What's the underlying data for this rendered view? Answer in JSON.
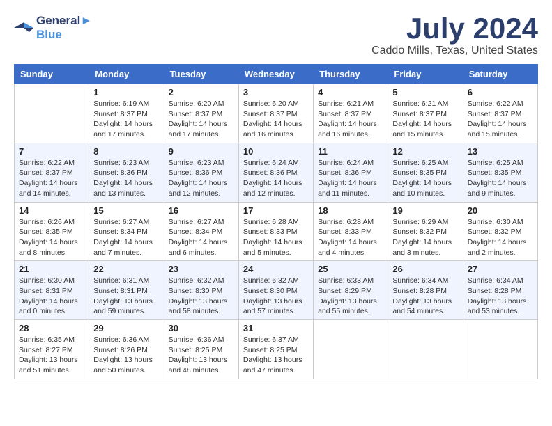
{
  "logo": {
    "line1": "General",
    "line2": "Blue"
  },
  "title": "July 2024",
  "location": "Caddo Mills, Texas, United States",
  "days_of_week": [
    "Sunday",
    "Monday",
    "Tuesday",
    "Wednesday",
    "Thursday",
    "Friday",
    "Saturday"
  ],
  "weeks": [
    [
      {
        "day": "",
        "info": ""
      },
      {
        "day": "1",
        "info": "Sunrise: 6:19 AM\nSunset: 8:37 PM\nDaylight: 14 hours\nand 17 minutes."
      },
      {
        "day": "2",
        "info": "Sunrise: 6:20 AM\nSunset: 8:37 PM\nDaylight: 14 hours\nand 17 minutes."
      },
      {
        "day": "3",
        "info": "Sunrise: 6:20 AM\nSunset: 8:37 PM\nDaylight: 14 hours\nand 16 minutes."
      },
      {
        "day": "4",
        "info": "Sunrise: 6:21 AM\nSunset: 8:37 PM\nDaylight: 14 hours\nand 16 minutes."
      },
      {
        "day": "5",
        "info": "Sunrise: 6:21 AM\nSunset: 8:37 PM\nDaylight: 14 hours\nand 15 minutes."
      },
      {
        "day": "6",
        "info": "Sunrise: 6:22 AM\nSunset: 8:37 PM\nDaylight: 14 hours\nand 15 minutes."
      }
    ],
    [
      {
        "day": "7",
        "info": "Sunrise: 6:22 AM\nSunset: 8:37 PM\nDaylight: 14 hours\nand 14 minutes."
      },
      {
        "day": "8",
        "info": "Sunrise: 6:23 AM\nSunset: 8:36 PM\nDaylight: 14 hours\nand 13 minutes."
      },
      {
        "day": "9",
        "info": "Sunrise: 6:23 AM\nSunset: 8:36 PM\nDaylight: 14 hours\nand 12 minutes."
      },
      {
        "day": "10",
        "info": "Sunrise: 6:24 AM\nSunset: 8:36 PM\nDaylight: 14 hours\nand 12 minutes."
      },
      {
        "day": "11",
        "info": "Sunrise: 6:24 AM\nSunset: 8:36 PM\nDaylight: 14 hours\nand 11 minutes."
      },
      {
        "day": "12",
        "info": "Sunrise: 6:25 AM\nSunset: 8:35 PM\nDaylight: 14 hours\nand 10 minutes."
      },
      {
        "day": "13",
        "info": "Sunrise: 6:25 AM\nSunset: 8:35 PM\nDaylight: 14 hours\nand 9 minutes."
      }
    ],
    [
      {
        "day": "14",
        "info": "Sunrise: 6:26 AM\nSunset: 8:35 PM\nDaylight: 14 hours\nand 8 minutes."
      },
      {
        "day": "15",
        "info": "Sunrise: 6:27 AM\nSunset: 8:34 PM\nDaylight: 14 hours\nand 7 minutes."
      },
      {
        "day": "16",
        "info": "Sunrise: 6:27 AM\nSunset: 8:34 PM\nDaylight: 14 hours\nand 6 minutes."
      },
      {
        "day": "17",
        "info": "Sunrise: 6:28 AM\nSunset: 8:33 PM\nDaylight: 14 hours\nand 5 minutes."
      },
      {
        "day": "18",
        "info": "Sunrise: 6:28 AM\nSunset: 8:33 PM\nDaylight: 14 hours\nand 4 minutes."
      },
      {
        "day": "19",
        "info": "Sunrise: 6:29 AM\nSunset: 8:32 PM\nDaylight: 14 hours\nand 3 minutes."
      },
      {
        "day": "20",
        "info": "Sunrise: 6:30 AM\nSunset: 8:32 PM\nDaylight: 14 hours\nand 2 minutes."
      }
    ],
    [
      {
        "day": "21",
        "info": "Sunrise: 6:30 AM\nSunset: 8:31 PM\nDaylight: 14 hours\nand 0 minutes."
      },
      {
        "day": "22",
        "info": "Sunrise: 6:31 AM\nSunset: 8:31 PM\nDaylight: 13 hours\nand 59 minutes."
      },
      {
        "day": "23",
        "info": "Sunrise: 6:32 AM\nSunset: 8:30 PM\nDaylight: 13 hours\nand 58 minutes."
      },
      {
        "day": "24",
        "info": "Sunrise: 6:32 AM\nSunset: 8:30 PM\nDaylight: 13 hours\nand 57 minutes."
      },
      {
        "day": "25",
        "info": "Sunrise: 6:33 AM\nSunset: 8:29 PM\nDaylight: 13 hours\nand 55 minutes."
      },
      {
        "day": "26",
        "info": "Sunrise: 6:34 AM\nSunset: 8:28 PM\nDaylight: 13 hours\nand 54 minutes."
      },
      {
        "day": "27",
        "info": "Sunrise: 6:34 AM\nSunset: 8:28 PM\nDaylight: 13 hours\nand 53 minutes."
      }
    ],
    [
      {
        "day": "28",
        "info": "Sunrise: 6:35 AM\nSunset: 8:27 PM\nDaylight: 13 hours\nand 51 minutes."
      },
      {
        "day": "29",
        "info": "Sunrise: 6:36 AM\nSunset: 8:26 PM\nDaylight: 13 hours\nand 50 minutes."
      },
      {
        "day": "30",
        "info": "Sunrise: 6:36 AM\nSunset: 8:25 PM\nDaylight: 13 hours\nand 48 minutes."
      },
      {
        "day": "31",
        "info": "Sunrise: 6:37 AM\nSunset: 8:25 PM\nDaylight: 13 hours\nand 47 minutes."
      },
      {
        "day": "",
        "info": ""
      },
      {
        "day": "",
        "info": ""
      },
      {
        "day": "",
        "info": ""
      }
    ]
  ]
}
